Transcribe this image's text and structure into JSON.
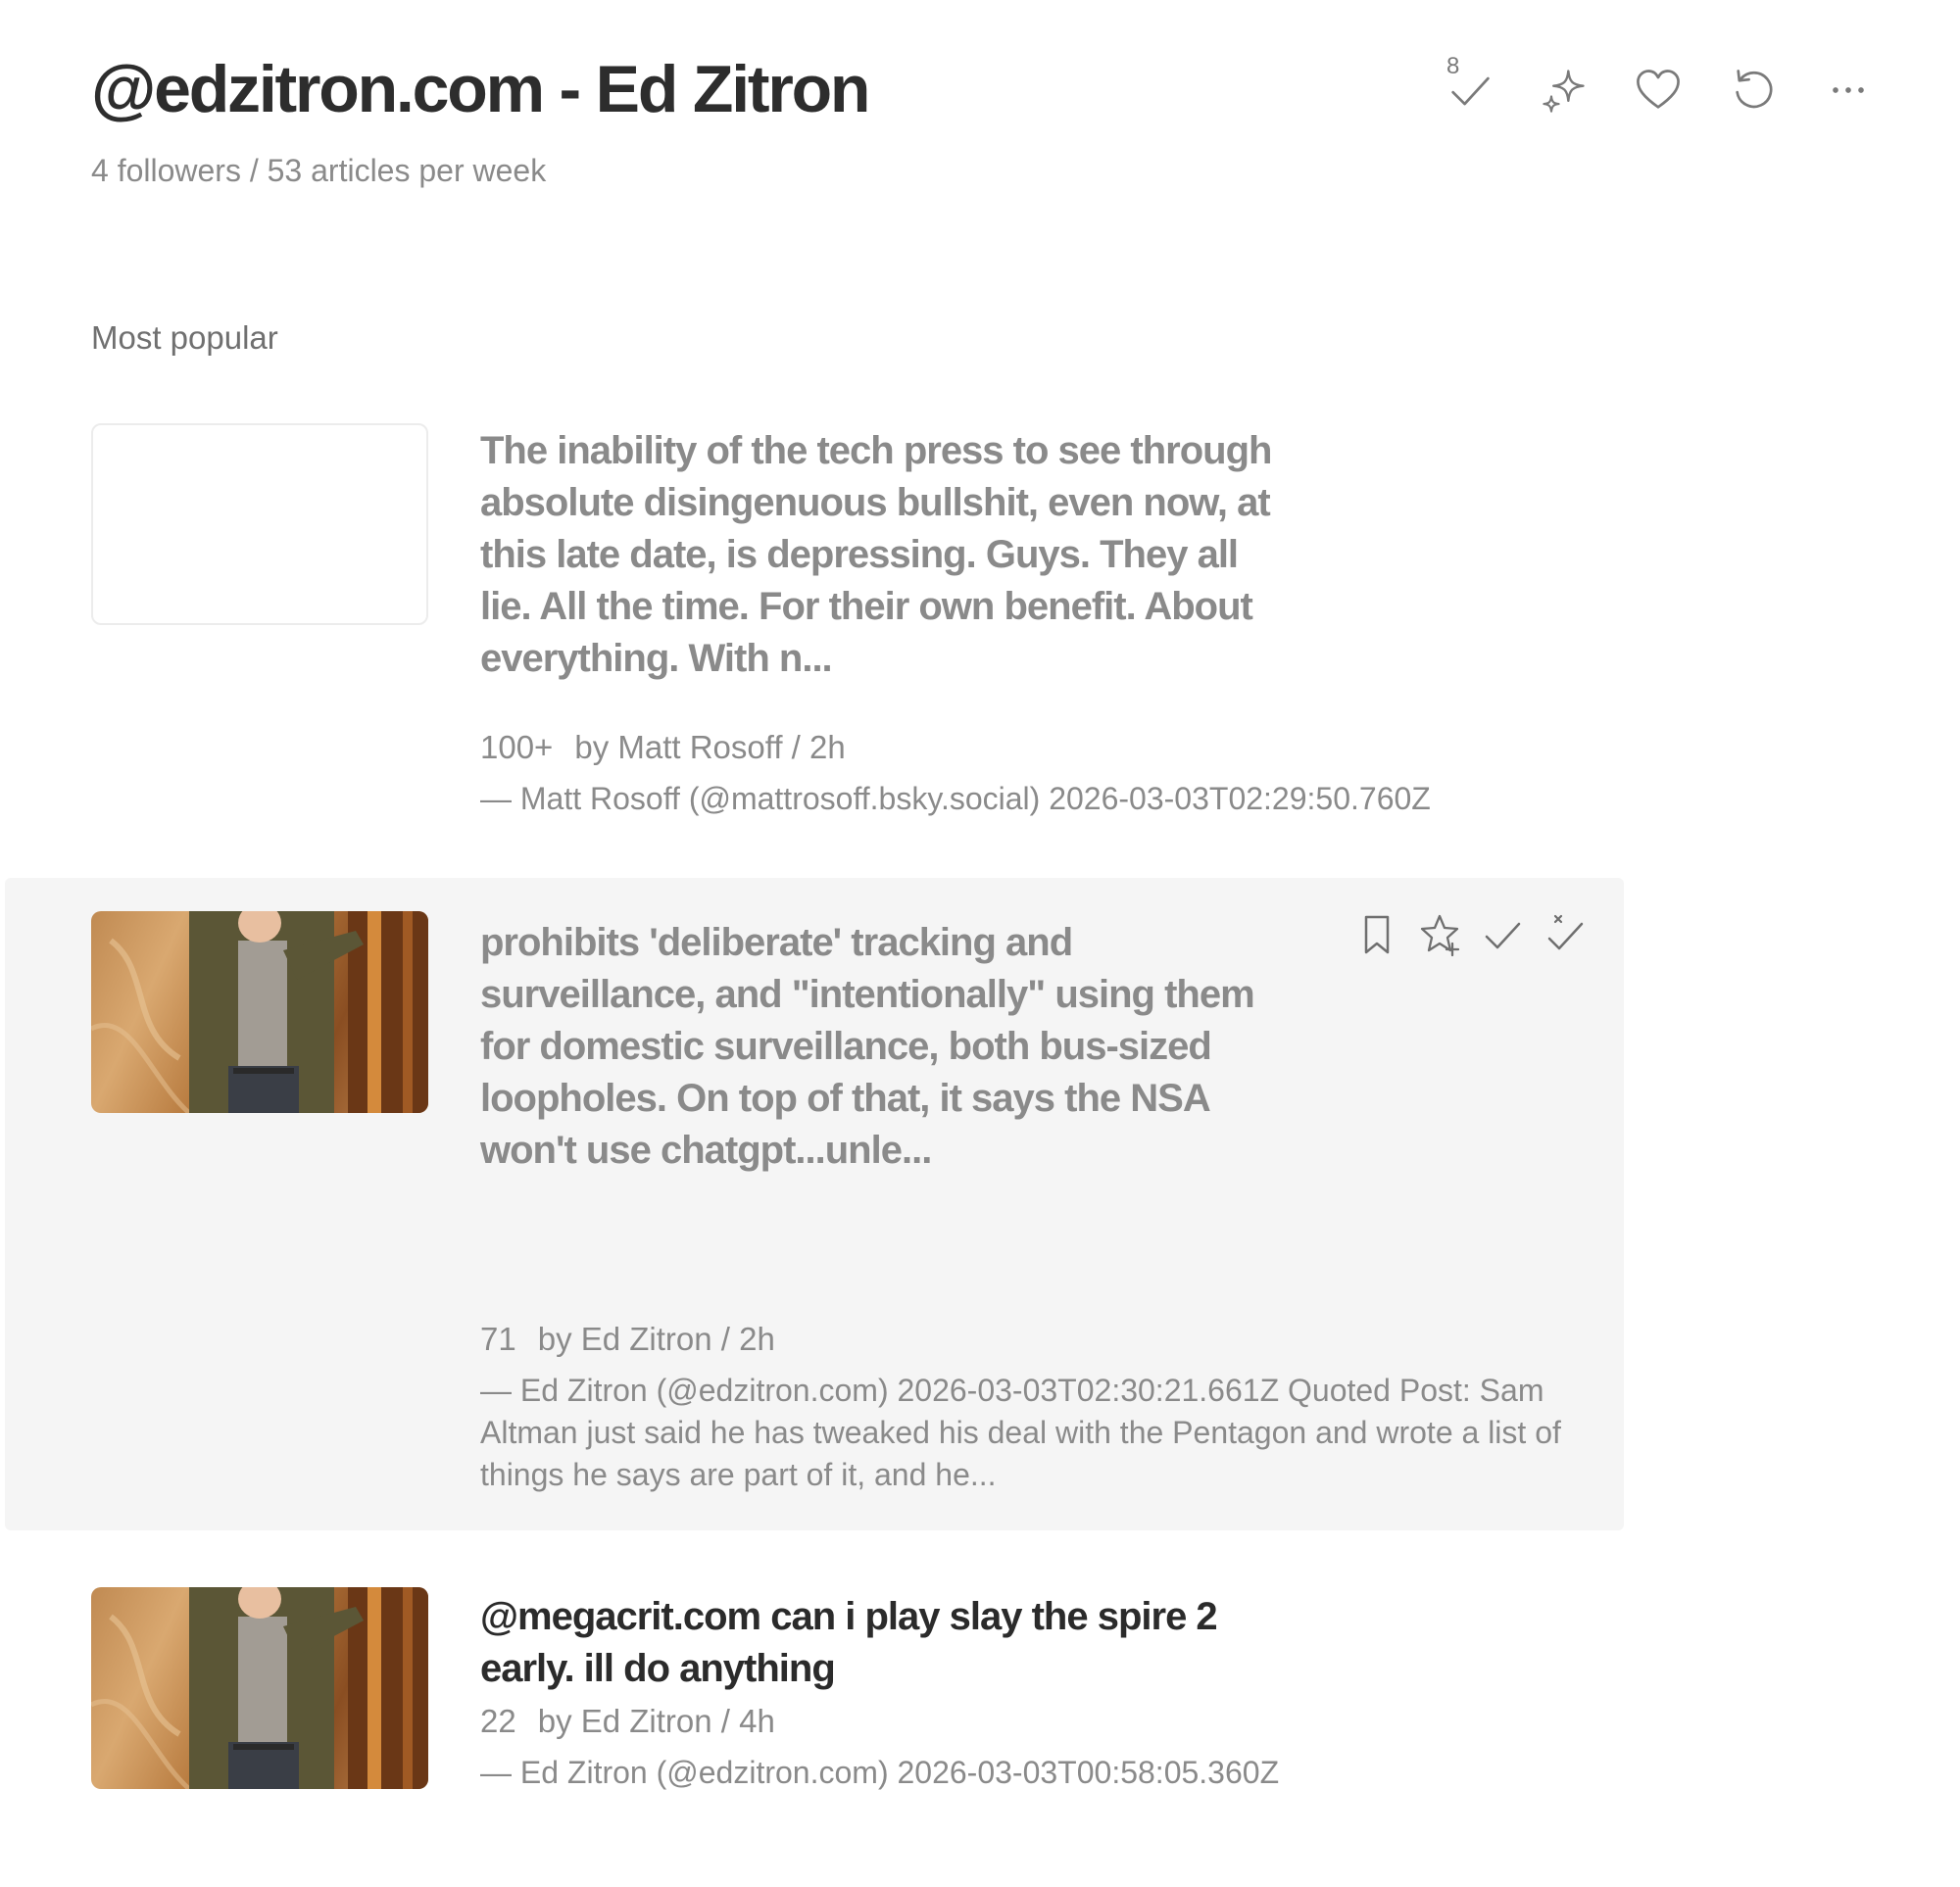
{
  "header": {
    "title": "@edzitron.com - Ed Zitron",
    "meta": "4 followers / 53 articles per week",
    "mark_read_count": "8",
    "tools": [
      "check-icon",
      "sparkles-icon",
      "heart-icon",
      "refresh-icon",
      "more-icon"
    ]
  },
  "section": {
    "label": "Most popular"
  },
  "articles": [
    {
      "title": "The inability of the tech press to see through absolute disingenuous bullshit, even now, at this late date, is depressing. Guys. They all lie. All the time. For their own benefit. About everything. With n...",
      "count": "100+",
      "byline": "by Matt Rosoff / 2h",
      "snippet": "— Matt Rosoff (@mattrosoff.bsky.social) 2026-03-03T02:29:50.760Z",
      "thumbnail": "empty",
      "read": true
    },
    {
      "title": "prohibits 'deliberate' tracking and surveillance, and \"intentionally\" using them for domestic surveillance, both bus-sized loopholes. On top of that, it says the NSA won't use chatgpt...unle...",
      "count": "71",
      "byline": "by Ed Zitron / 2h",
      "snippet": "— Ed Zitron (@edzitron.com) 2026-03-03T02:30:21.661Z Quoted Post: Sam Altman just said he has tweaked his deal with the Pentagon and wrote a list of things he says are part of it, and he...",
      "thumbnail": "photo",
      "read": true,
      "hovered": true
    },
    {
      "title": "@megacrit.com can i play slay the spire 2 early. ill do anything",
      "count": "22",
      "byline": "by Ed Zitron / 4h",
      "snippet": "— Ed Zitron (@edzitron.com) 2026-03-03T00:58:05.360Z",
      "thumbnail": "photo",
      "read": false
    }
  ],
  "row_actions": [
    "bookmark-icon",
    "star-add-icon",
    "check-icon",
    "check-above-icon"
  ],
  "colors": {
    "text_dark": "#2b2b2b",
    "text_muted": "#8a8a8a",
    "hover_bg": "#f5f5f5"
  }
}
